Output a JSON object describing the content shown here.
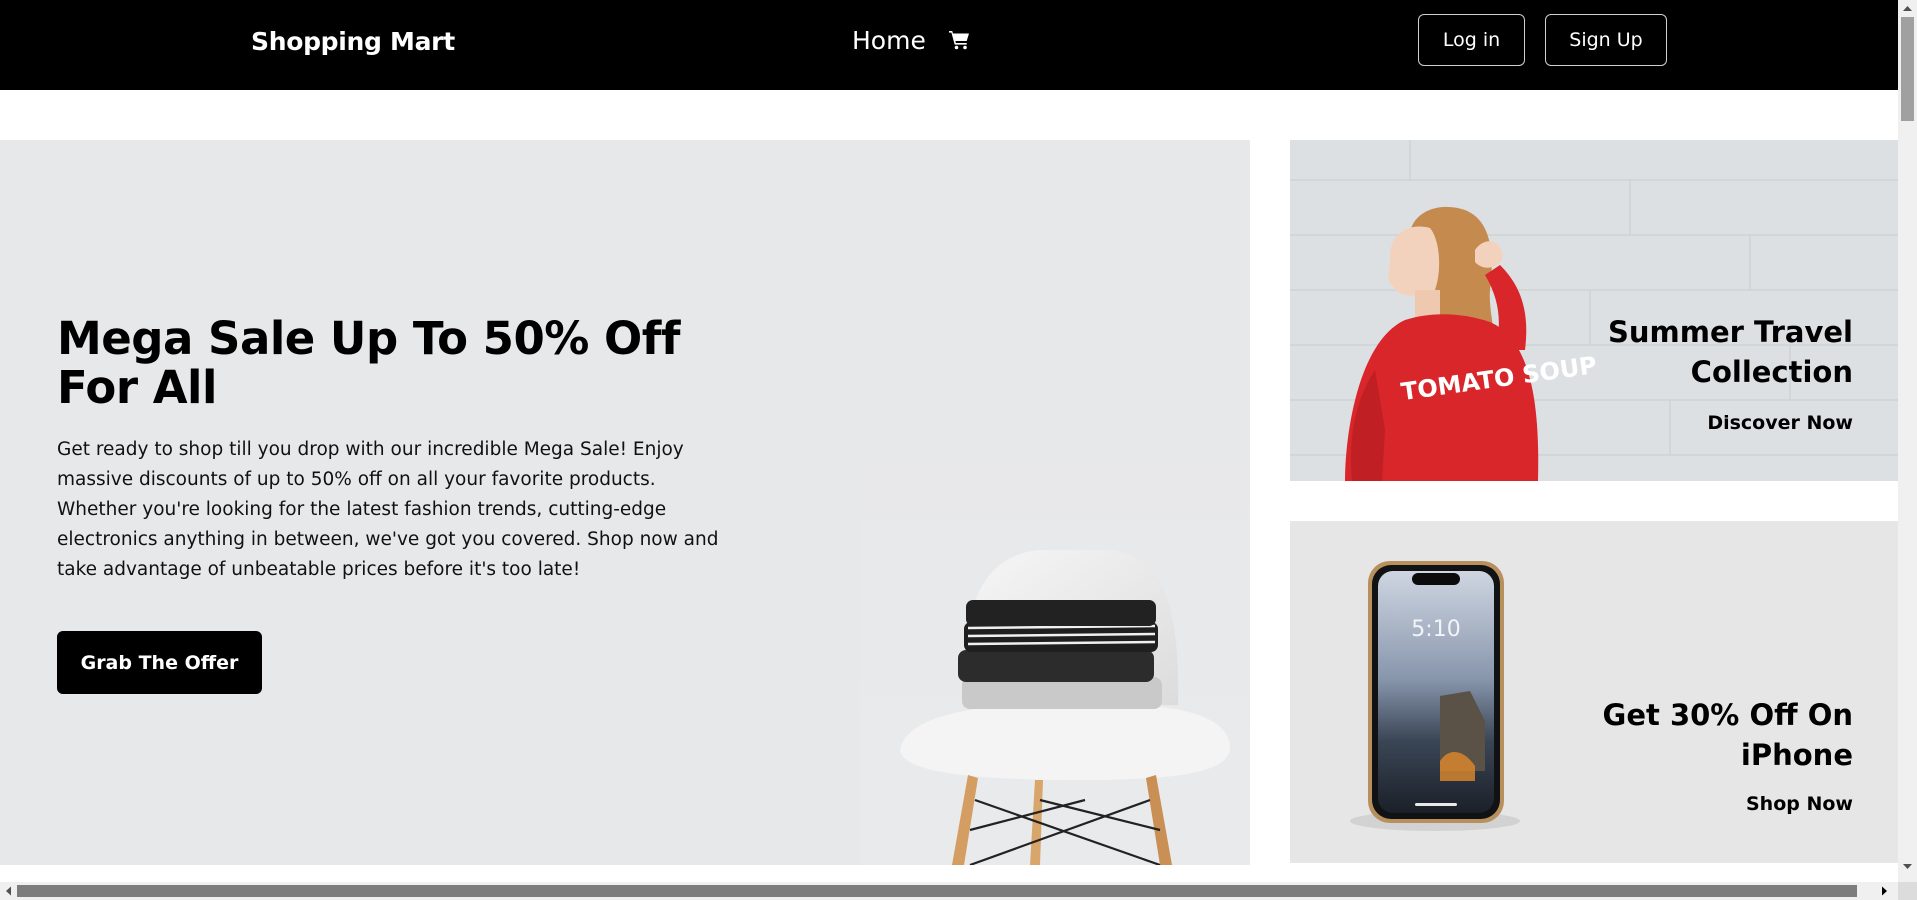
{
  "navbar": {
    "brand": "Shopping Mart",
    "home_label": "Home",
    "cart_icon": "shopping-cart-icon",
    "login_label": "Log in",
    "signup_label": "Sign Up"
  },
  "hero": {
    "title": "Mega Sale Up To 50% Off For All",
    "description": "Get ready to shop till you drop with our incredible Mega Sale! Enjoy massive discounts of up to 50% off on all your favorite products. Whether you're looking for the latest fashion trends, cutting-edge electronics anything in between, we've got you covered. Shop now and take advantage of unbeatable prices before it's too late!",
    "cta_label": "Grab The Offer"
  },
  "promos": [
    {
      "title": "Summer Travel Collection",
      "link": "Discover Now",
      "shirt_text": "TOMATO SOUP"
    },
    {
      "title": "Get 30% Off On iPhone",
      "link": "Shop Now",
      "phone_time": "5:10"
    }
  ],
  "colors": {
    "nav_bg": "#000000",
    "hero_bg": "#e7e8ea",
    "promo_bg": "#e4e5e7",
    "shirt_red": "#d8262b"
  }
}
